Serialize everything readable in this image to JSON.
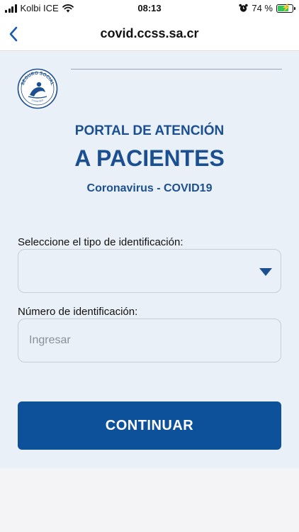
{
  "status_bar": {
    "carrier": "Kolbi ICE",
    "time": "08:13",
    "battery_percent": "74 %",
    "battery_level": 0.74
  },
  "nav": {
    "url": "covid.ccss.sa.cr",
    "back_icon": "chevron-left-icon"
  },
  "portal": {
    "logo_text": "SEGURO SOCIAL",
    "logo_subtext": "COSTA RICA",
    "title_line1": "PORTAL DE ATENCIÓN",
    "title_line2": "A PACIENTES",
    "subtitle": "Coronavirus - COVID19"
  },
  "form": {
    "id_type_label": "Seleccione el tipo de identificación:",
    "id_type_value": "",
    "id_number_label": "Número de identificación:",
    "id_number_placeholder": "Ingresar",
    "submit_label": "CONTINUAR"
  },
  "colors": {
    "brand_blue": "#0d519b",
    "title_blue": "#1b4f8f",
    "panel_bg": "#eaf0f7",
    "battery_green": "#34c759"
  }
}
